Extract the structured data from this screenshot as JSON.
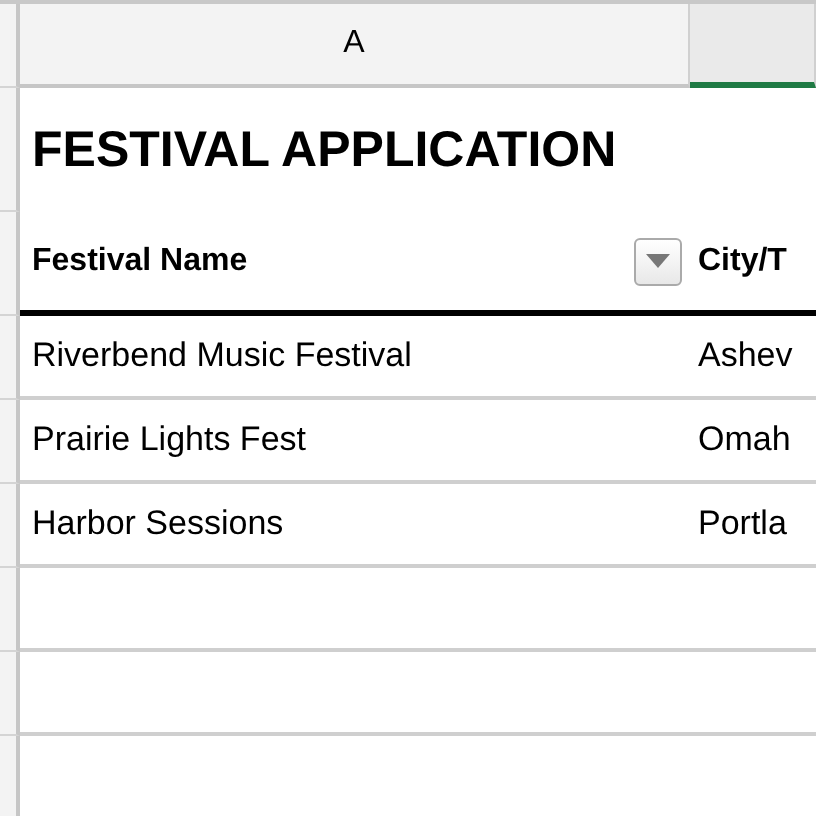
{
  "column_headers": [
    {
      "label": "A",
      "selected": false
    },
    {
      "selected": true
    }
  ],
  "title": "FESTIVAL APPLICATION",
  "table": {
    "columns": [
      {
        "label": "Festival Name",
        "filter": true
      },
      {
        "label": "City/T",
        "filter": false
      }
    ],
    "rows": [
      [
        "Riverbend Music Festival",
        "Ashev"
      ],
      [
        "Prairie Lights Fest",
        "Omah"
      ],
      [
        "Harbor Sessions",
        "Portla"
      ]
    ]
  }
}
